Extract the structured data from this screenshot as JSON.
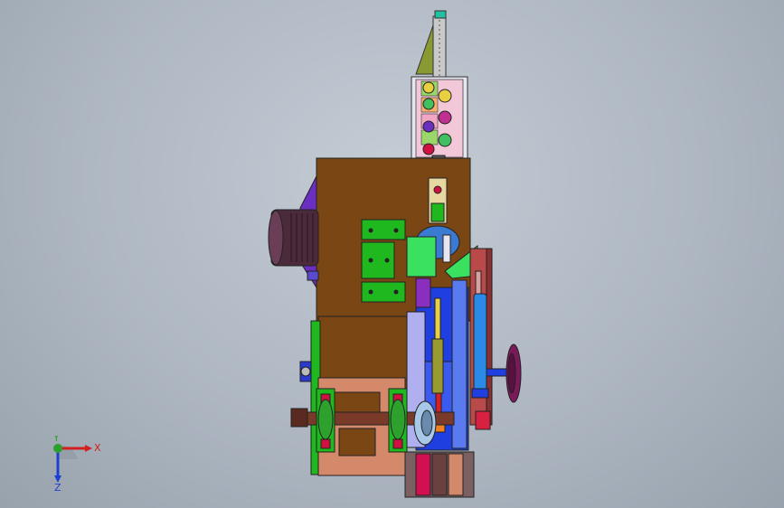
{
  "viewport": {
    "background": "#b3bcc7"
  },
  "triad": {
    "x_label": "X",
    "y_label": "Y",
    "z_label": "Z",
    "x_color": "#d21f1f",
    "y_color": "#2ca02c",
    "z_color": "#1f3fd2"
  },
  "colors": {
    "main_plate": "#7a4614",
    "motor": "#4b2a3c",
    "motor_mount": "#6a2ec0",
    "green_plate": "#1fb81f",
    "blue_frame": "#1f3fe0",
    "pink_frame": "#d48a6a",
    "handwheel": "#7a1a5a",
    "top_block": "#e6e6f0"
  }
}
